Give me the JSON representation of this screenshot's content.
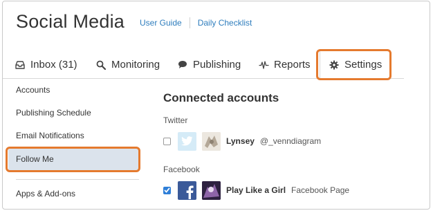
{
  "header": {
    "title": "Social Media",
    "links": [
      "User Guide",
      "Daily Checklist"
    ]
  },
  "tabs": [
    {
      "label": "Inbox (31)",
      "icon": "inbox-icon"
    },
    {
      "label": "Monitoring",
      "icon": "search-icon"
    },
    {
      "label": "Publishing",
      "icon": "speech-bubble-icon"
    },
    {
      "label": "Reports",
      "icon": "pulse-icon"
    },
    {
      "label": "Settings",
      "icon": "gear-icon",
      "active": true
    }
  ],
  "sidebar": {
    "items": [
      "Accounts",
      "Publishing Schedule",
      "Email Notifications",
      "Follow Me",
      "Apps & Add-ons"
    ],
    "selected": "Follow Me"
  },
  "main": {
    "title": "Connected accounts",
    "sections": [
      {
        "label": "Twitter",
        "accounts": [
          {
            "name": "Lynsey",
            "sub": "@_venndiagram",
            "checked": false
          }
        ]
      },
      {
        "label": "Facebook",
        "accounts": [
          {
            "name": "Play Like a Girl",
            "sub": "Facebook Page",
            "checked": true
          }
        ]
      }
    ]
  },
  "colors": {
    "link": "#2e7dbd",
    "highlight": "#e57a2e",
    "selected_bg": "#dbe3ec",
    "checkbox": "#2f7fd8",
    "facebook": "#3b5a99",
    "twitter": "#d5ebf7"
  }
}
